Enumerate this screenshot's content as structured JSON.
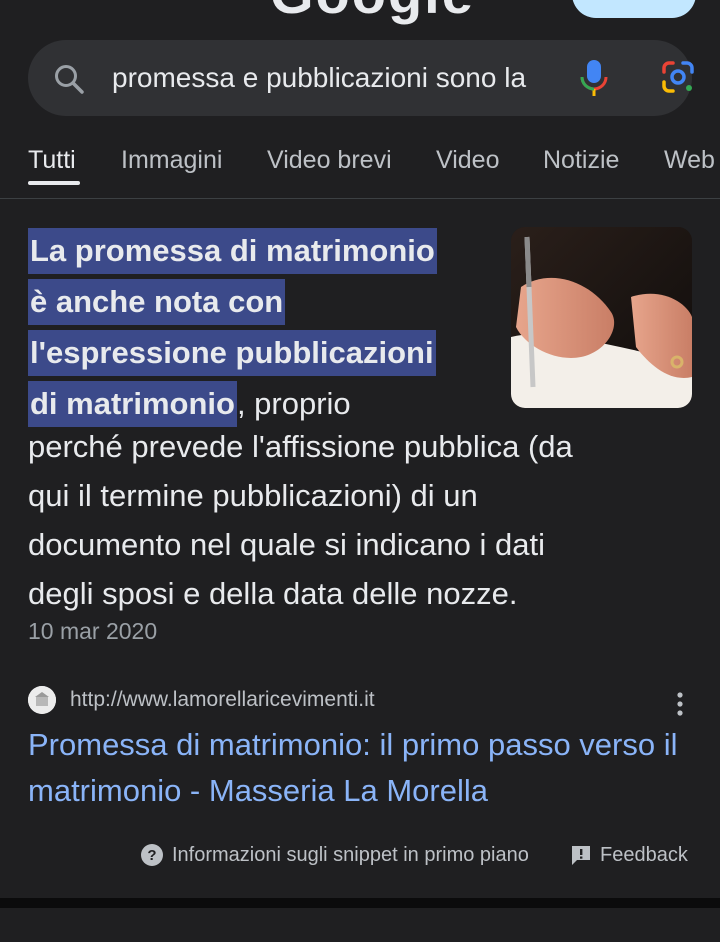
{
  "header": {
    "logo_partial": "Google"
  },
  "search": {
    "query": "promessa e pubblicazioni sono la",
    "icons": [
      "search-icon",
      "mic-icon",
      "google-lens-icon"
    ]
  },
  "tabs": [
    {
      "label": "Tutti",
      "active": true
    },
    {
      "label": "Immagini",
      "active": false
    },
    {
      "label": "Video brevi",
      "active": false
    },
    {
      "label": "Video",
      "active": false
    },
    {
      "label": "Notizie",
      "active": false
    },
    {
      "label": "Web",
      "active": false
    }
  ],
  "snippet": {
    "highlight_lines": [
      "La promessa di matrimonio",
      "è anche nota con",
      "l'espressione pubblicazioni",
      "di matrimonio"
    ],
    "after_highlight": ", proprio",
    "body_lines": [
      "perché prevede l'affissione pubblica (da",
      "qui il termine pubblicazioni) di un",
      "documento nel quale si indicano i dati",
      "degli sposi e della data delle nozze."
    ],
    "date": "10 mar 2020"
  },
  "result": {
    "url": "http://www.lamorellaricevimenti.it",
    "title": "Promessa di matrimonio: il primo passo verso il matrimonio - Masseria La Morella"
  },
  "footer": {
    "info_label": "Informazioni sugli snippet in primo piano",
    "feedback_label": "Feedback"
  },
  "colors": {
    "background": "#1f1f21",
    "highlight": "#3c4a8a",
    "link": "#8ab4f8",
    "text": "#e8eaed",
    "muted": "#9aa0a6"
  }
}
